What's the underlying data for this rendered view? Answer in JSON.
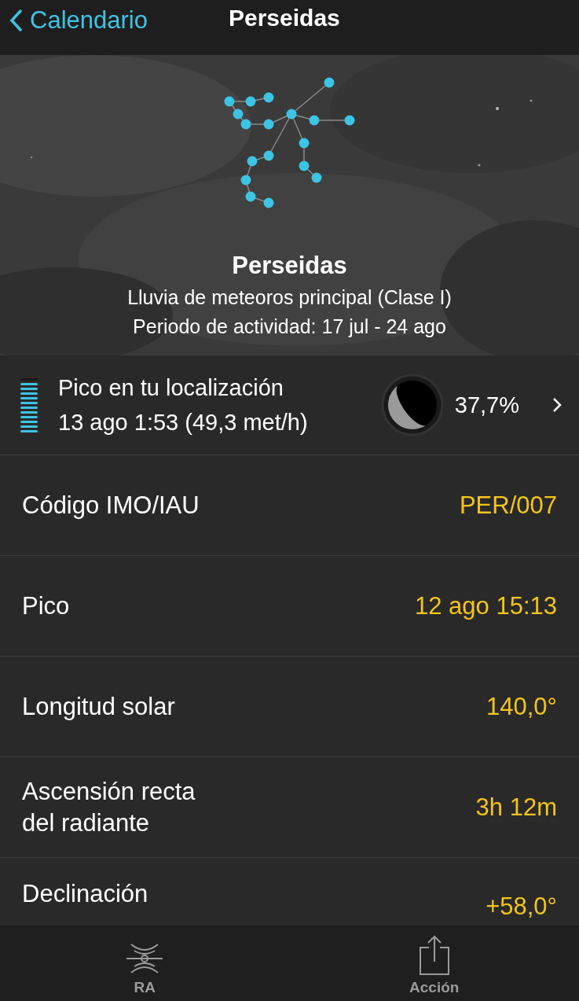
{
  "nav": {
    "back": "Calendario",
    "title": "Perseidas"
  },
  "hero": {
    "kind": "picture",
    "title": "Perseidas",
    "subtitle": "Lluvia de meteoros principal (Clase I)",
    "period": "Periodo de actividad: 17 jul - 24 ago"
  },
  "peak": {
    "title": "Pico en tu localización",
    "detail": "13 ago 1:53 (49,3 met/h)",
    "moon_illumination": "37,7%"
  },
  "rows": [
    {
      "label": [
        "Código IMO/IAU"
      ],
      "value": "PER/007"
    },
    {
      "label": [
        "Pico"
      ],
      "value": "12 ago 15:13"
    },
    {
      "label": [
        "Longitud solar"
      ],
      "value": "140,0°"
    },
    {
      "label": [
        "Ascensión recta",
        "del radiante"
      ],
      "value": "3h 12m"
    },
    {
      "label": [
        "Declinación"
      ],
      "value": "+58,0°"
    }
  ],
  "tabs": [
    {
      "kind": "radiant",
      "label": "RA"
    },
    {
      "kind": "share",
      "label": "Acción"
    }
  ]
}
